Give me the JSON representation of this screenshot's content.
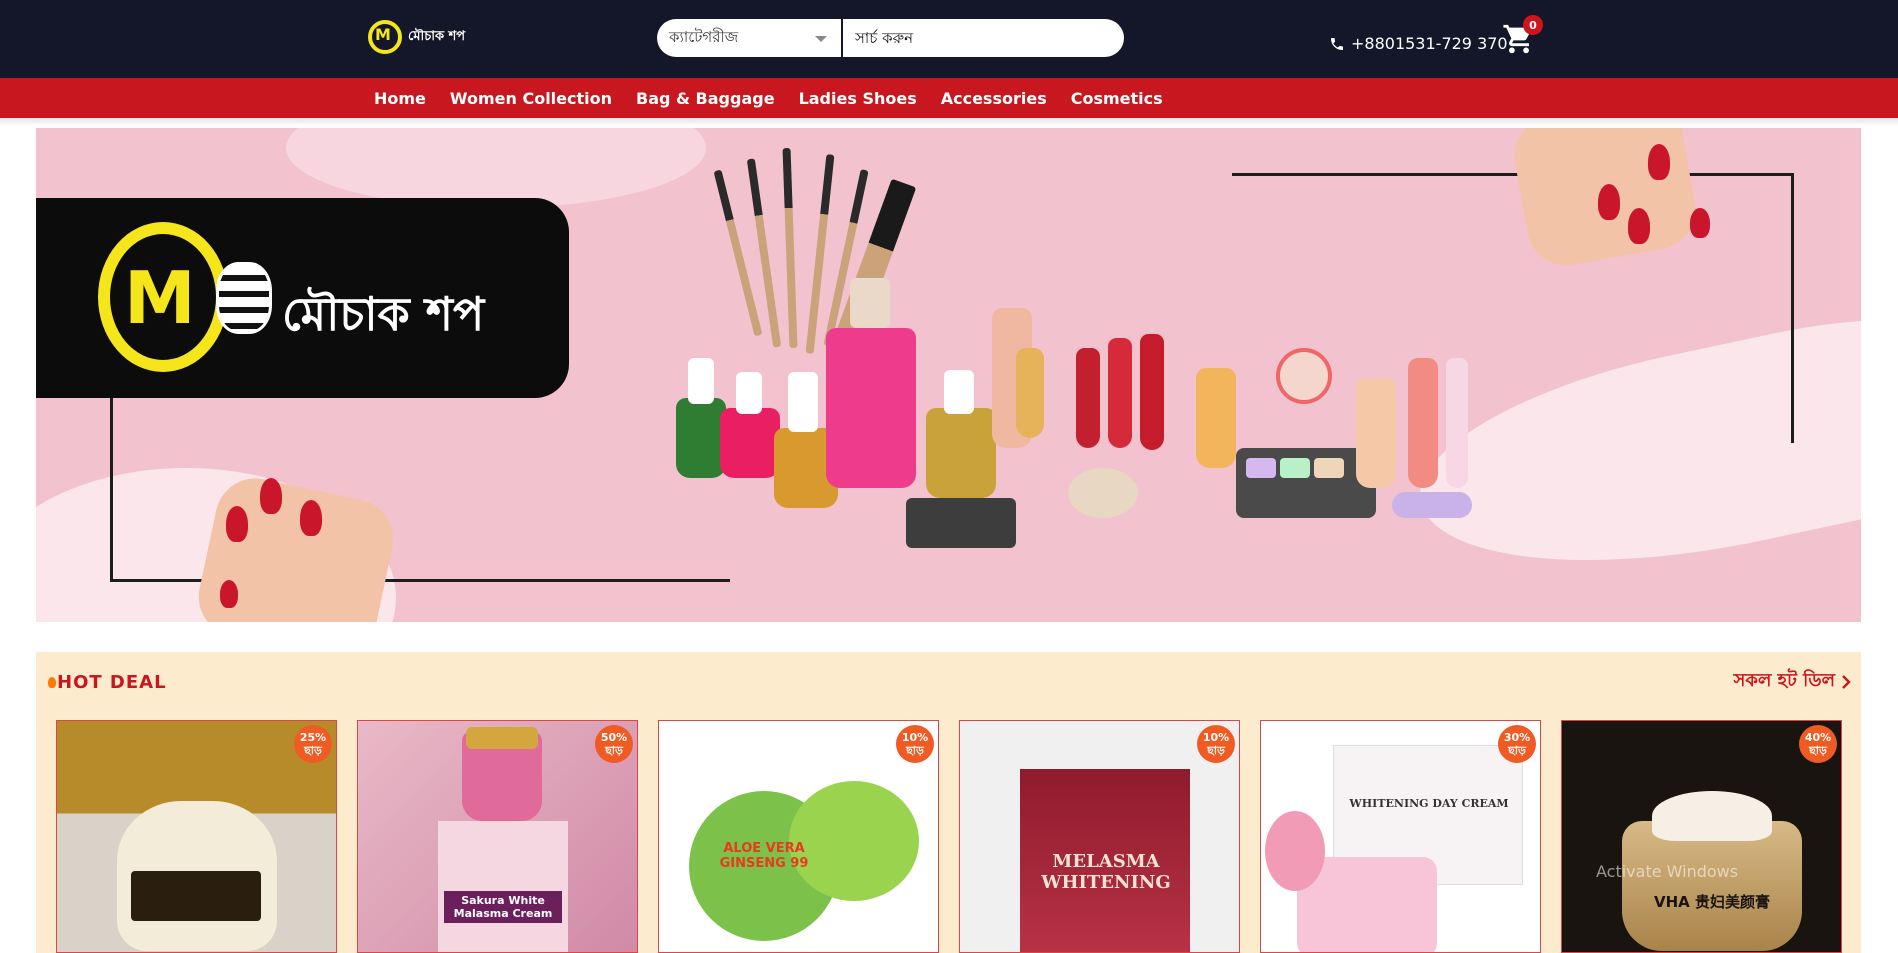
{
  "header": {
    "logo_text": "মৌচাক শপ",
    "category_select": "ক্যাটেগরীজ",
    "search_placeholder": "সার্চ করুন",
    "phone": "+8801531-729 370",
    "cart_count": "0"
  },
  "nav": {
    "items": [
      "Home",
      "Women Collection",
      "Bag & Baggage",
      "Ladies Shoes",
      "Accessories",
      "Cosmetics"
    ]
  },
  "hero": {
    "brand_text": "মৌচাক শপ",
    "slides_total": 3,
    "active_slide": 3
  },
  "hot_deal": {
    "title": "HOT DEAL",
    "view_all": "সকল হট ডিল",
    "products": [
      {
        "discount": "25%",
        "off_label": "ছাড়",
        "image_text": ""
      },
      {
        "discount": "50%",
        "off_label": "ছাড়",
        "image_text": "Sakura White Malasma Cream"
      },
      {
        "discount": "10%",
        "off_label": "ছাড়",
        "image_text": "ALOE VERA GINSENG 99"
      },
      {
        "discount": "10%",
        "off_label": "ছাড়",
        "image_text": "MELASMA WHITENING"
      },
      {
        "discount": "30%",
        "off_label": "ছাড়",
        "image_text": "WHITENING DAY CREAM"
      },
      {
        "discount": "40%",
        "off_label": "ছাড়",
        "image_text": "VHA 贵妇美颜膏"
      }
    ]
  },
  "watermark": "Activate Windows",
  "colors": {
    "topbar": "#14172a",
    "nav": "#c8171e",
    "hero_bg": "#f2c2cf",
    "hotdeal_bg": "#fdebcd",
    "badge": "#f05a23",
    "logo_yellow": "#f5e51b"
  }
}
